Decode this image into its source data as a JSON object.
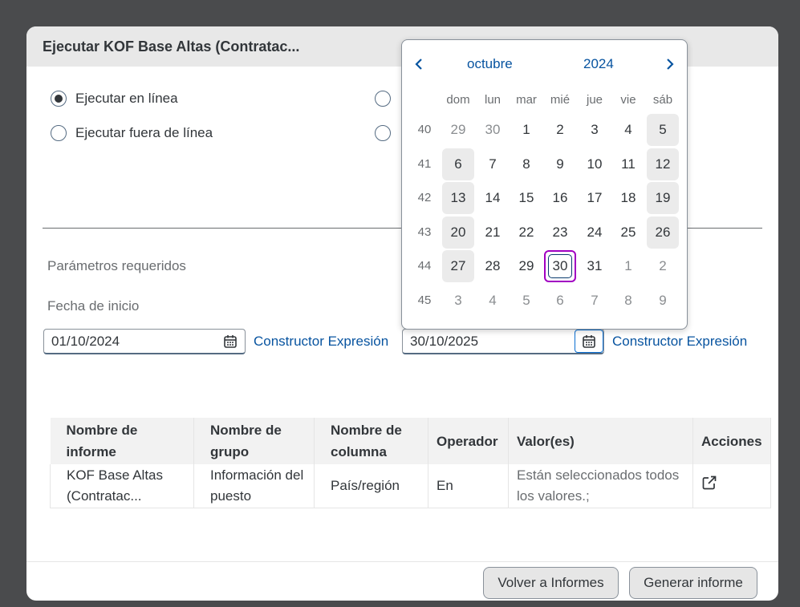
{
  "dialog": {
    "title": "Ejecutar KOF Base Altas (Contratac...",
    "options": [
      {
        "label": "Ejecutar en línea",
        "checked": true
      },
      {
        "label": "Ejecutar fuera de línea",
        "checked": false
      },
      {
        "label": "",
        "checked": false
      },
      {
        "label": "",
        "checked": false
      }
    ],
    "section_label": "Parámetros requeridos",
    "start_label": "Fecha de inicio",
    "start_date": "01/10/2024",
    "end_date": "30/10/2025",
    "expr_link_1": "Constructor Expresión",
    "expr_link_2": "Constructor Expresión"
  },
  "table": {
    "headers": [
      "Nombre de informe",
      "Nombre de grupo",
      "Nombre de columna",
      "Operador",
      "Valor(es)",
      "Acciones"
    ],
    "rows": [
      [
        "KOF Base Altas (Contratac...",
        "Información del puesto",
        "País/región",
        "En",
        "Están seleccionados todos los valores.;",
        "export-icon"
      ]
    ]
  },
  "footer": {
    "back_label": "Volver a Informes",
    "generate_label": "Generar informe"
  },
  "calendar": {
    "month": "octubre",
    "year": "2024",
    "weekdays": [
      "dom",
      "lun",
      "mar",
      "mié",
      "jue",
      "vie",
      "sáb"
    ],
    "weeks": [
      {
        "num": "40",
        "days": [
          "29",
          "30",
          "1",
          "2",
          "3",
          "4",
          "5"
        ]
      },
      {
        "num": "41",
        "days": [
          "6",
          "7",
          "8",
          "9",
          "10",
          "11",
          "12"
        ]
      },
      {
        "num": "42",
        "days": [
          "13",
          "14",
          "15",
          "16",
          "17",
          "18",
          "19"
        ]
      },
      {
        "num": "43",
        "days": [
          "20",
          "21",
          "22",
          "23",
          "24",
          "25",
          "26"
        ]
      },
      {
        "num": "44",
        "days": [
          "27",
          "28",
          "29",
          "30",
          "31",
          "1",
          "2"
        ]
      },
      {
        "num": "45",
        "days": [
          "3",
          "4",
          "5",
          "6",
          "7",
          "8",
          "9"
        ]
      }
    ],
    "selected_day": "30",
    "colors": {
      "accent": "#0854a0",
      "selected_border": "#a100c2",
      "weekend_bg": "#ebebeb"
    }
  }
}
